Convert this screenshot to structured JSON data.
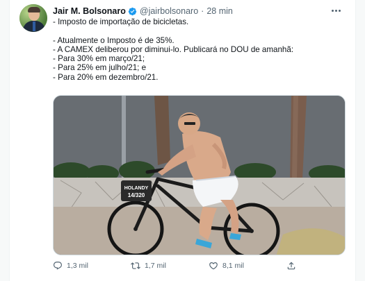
{
  "tweet": {
    "author_name": "Jair M. Bolsonaro",
    "handle": "@jairbolsonaro",
    "separator": "·",
    "time": "28 min",
    "lines": [
      "- Imposto de importação de bicicletas.",
      "",
      "- Atualmente o Imposto é de 35%.",
      "- A CAMEX deliberou por diminui-lo. Publicará no DOU  de amanhã:",
      "- Para 30% em março/21;",
      "- Para 25% em julho/21; e",
      "- Para 20% em dezembro/21."
    ],
    "photo_box_label_line1": "HOLANDY",
    "photo_box_label_line2": "14/320"
  },
  "actions": {
    "reply_count": "1,3 mil",
    "retweet_count": "1,7 mil",
    "like_count": "8,1 mil"
  },
  "icons": {
    "verified": "verified-badge-icon",
    "more": "more-icon",
    "reply": "reply-icon",
    "retweet": "retweet-icon",
    "like": "heart-icon",
    "share": "share-icon"
  },
  "colors": {
    "verified_blue": "#1d9bf0",
    "secondary_text": "#536471"
  }
}
